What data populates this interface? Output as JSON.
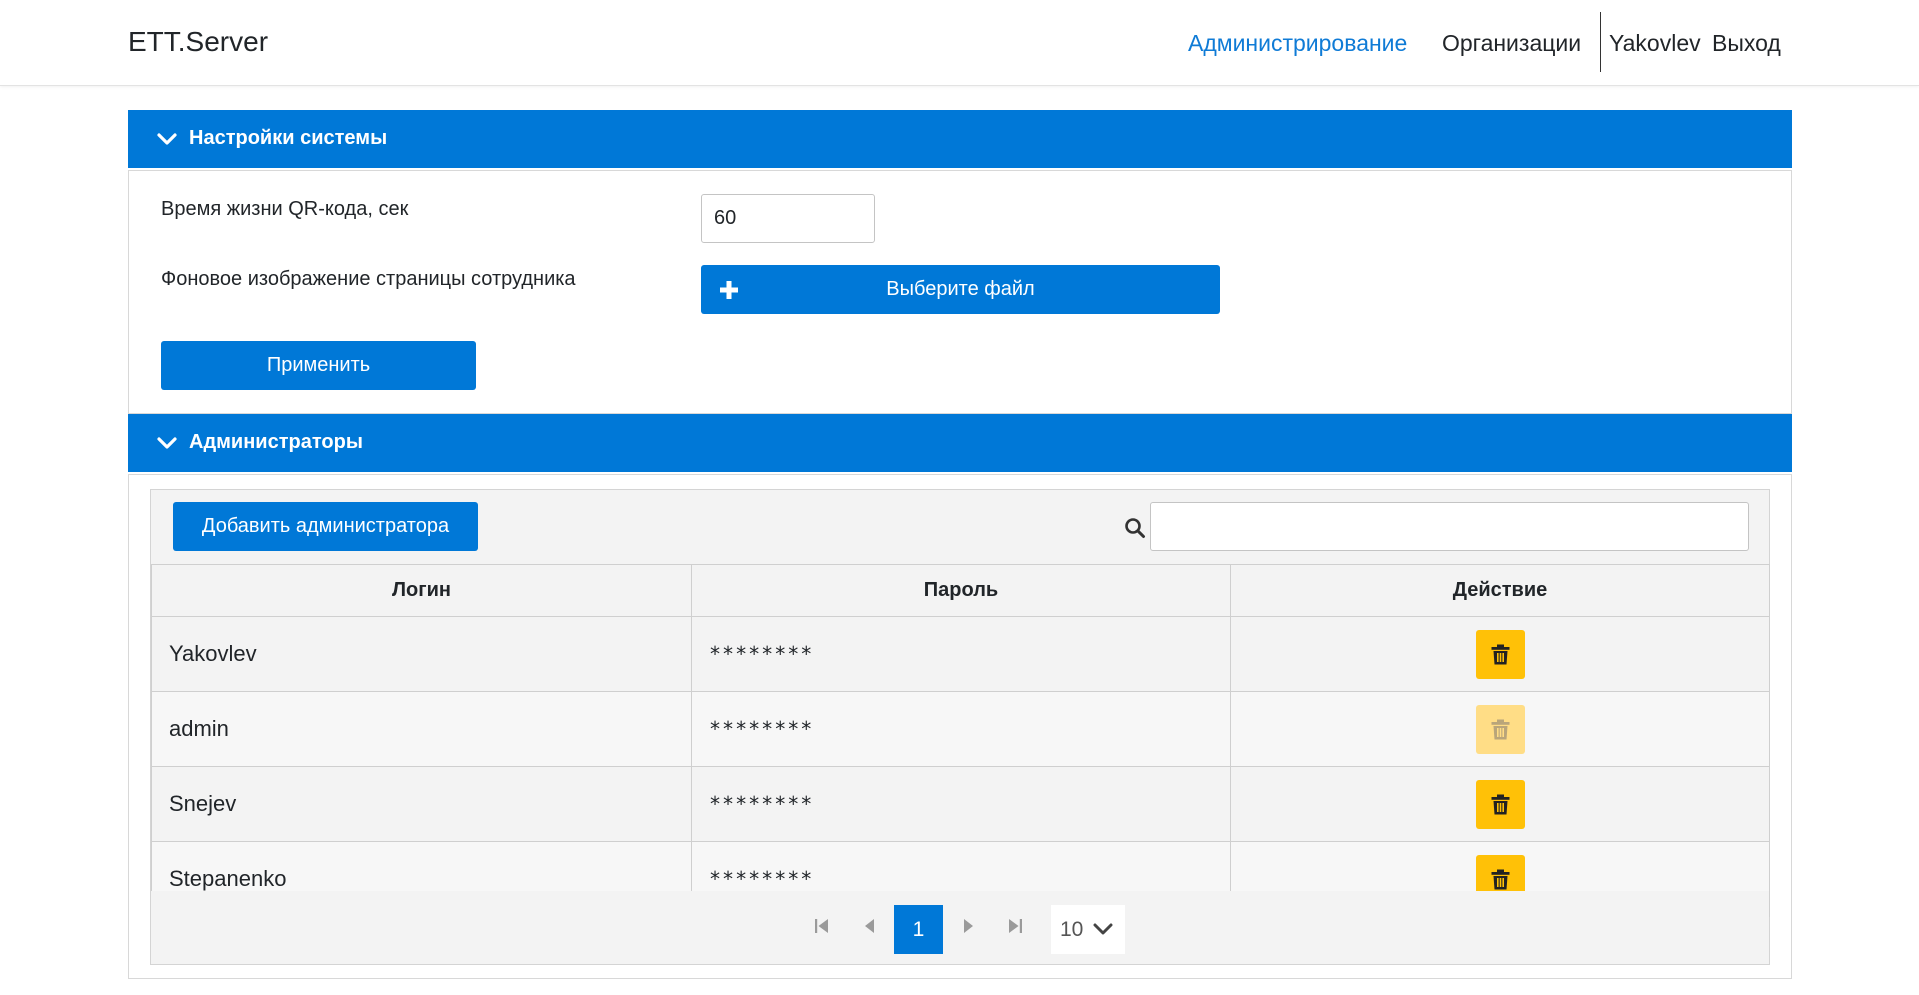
{
  "navbar": {
    "brand": "ETT.Server",
    "links": [
      {
        "label": "Администрирование"
      },
      {
        "label": "Организации"
      }
    ],
    "user": "Yakovlev",
    "logout": "Выход"
  },
  "colors": {
    "primary": "#0078d7",
    "active_link": "#0f7bd6",
    "delete_button": "#ffc107",
    "delete_button_disabled": "#ffdd86"
  },
  "settings": {
    "title": "Настройки системы",
    "qr_label": "Время жизни QR-кода, сек",
    "qr_value": "60",
    "background_label": "Фоновое изображение страницы сотрудника",
    "choose_file": "Выберите файл",
    "apply": "Применить"
  },
  "admins": {
    "title": "Администраторы",
    "add_button": "Добавить администратора",
    "search_value": "",
    "columns": [
      "Логин",
      "Пароль",
      "Действие"
    ],
    "rows": [
      {
        "login": "Yakovlev",
        "password": "********",
        "delete_enabled": true
      },
      {
        "login": "admin",
        "password": "********",
        "delete_enabled": false
      },
      {
        "login": "Snejev",
        "password": "********",
        "delete_enabled": true
      },
      {
        "login": "Stepanenko",
        "password": "********",
        "delete_enabled": true
      }
    ],
    "pager": {
      "current_page": "1",
      "page_size": "10"
    }
  },
  "icons": [
    "chevron-down-icon",
    "plus-icon",
    "search-icon",
    "trash-icon",
    "first-page-icon",
    "prev-page-icon",
    "next-page-icon",
    "last-page-icon"
  ]
}
